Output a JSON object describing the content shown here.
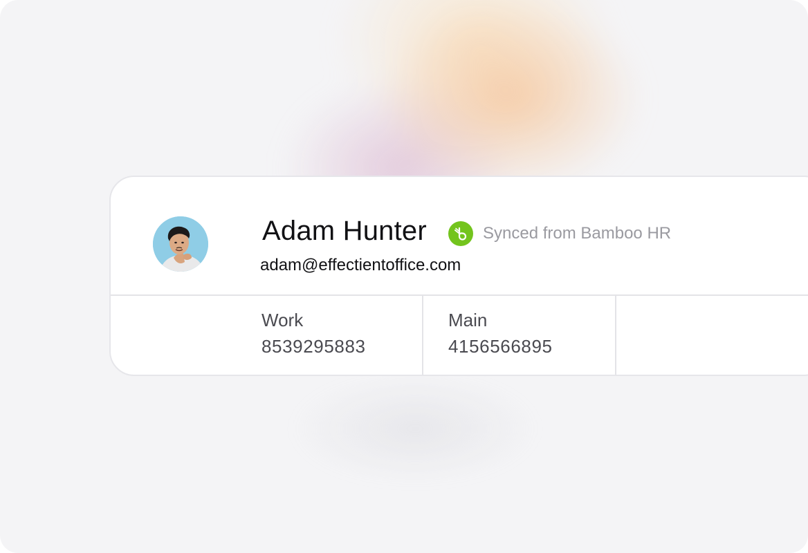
{
  "contact": {
    "name": "Adam Hunter",
    "email": "adam@effectientoffice.com",
    "sync_source": {
      "text": "Synced from Bamboo HR",
      "icon": "bamboohr-logo-icon",
      "color": "#73c41d"
    },
    "avatar": {
      "icon": "avatar",
      "background_color": "#8fcde6"
    },
    "phones": [
      {
        "label": "Work",
        "number": "8539295883"
      },
      {
        "label": "Main",
        "number": "4156566895"
      }
    ]
  },
  "colors": {
    "background": "#f4f4f6",
    "card": "#ffffff",
    "divider": "#e3e3e7",
    "muted_text": "#9a9aa0"
  }
}
